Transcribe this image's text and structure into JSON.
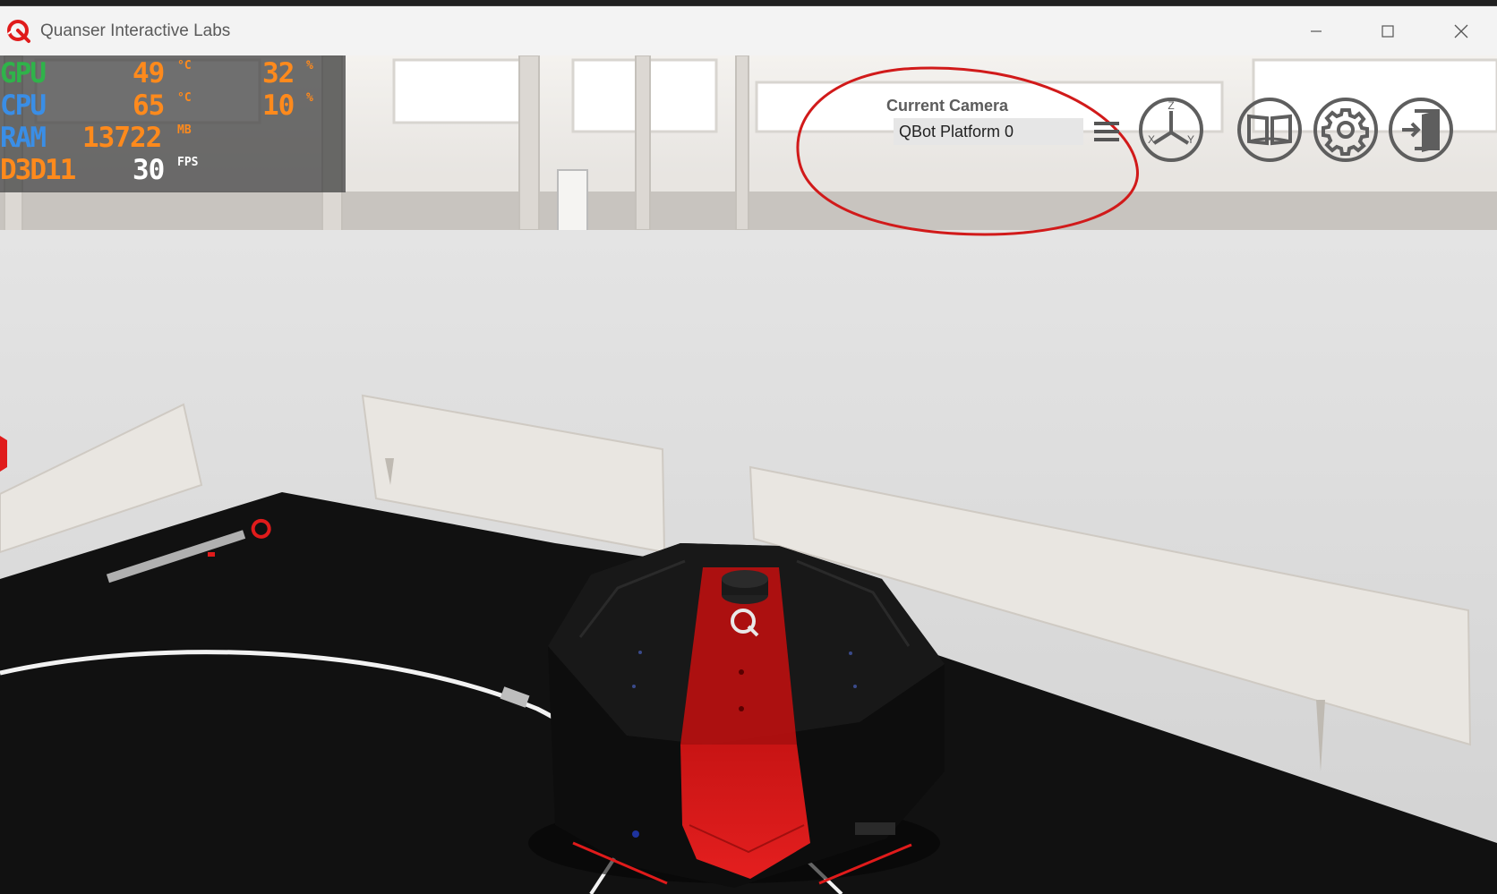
{
  "window": {
    "title": "Quanser Interactive Labs"
  },
  "perf_overlay": {
    "rows": [
      {
        "label": "GPU",
        "value1": "49",
        "unit1": "°C",
        "value2": "32",
        "unit2": "%",
        "label_color": "#2fb34a"
      },
      {
        "label": "CPU",
        "value1": "65",
        "unit1": "°C",
        "value2": "10",
        "unit2": "%",
        "label_color": "#3a8ee6"
      },
      {
        "label": "RAM",
        "value1": "13722",
        "unit1": "MB",
        "label_color": "#3a8ee6"
      },
      {
        "label": "D3D11",
        "value1": "30",
        "unit1": "FPS",
        "label_color": "#ff8a1c"
      }
    ]
  },
  "camera": {
    "label": "Current Camera",
    "selected": "QBot Platform 0"
  },
  "toolbar": {
    "axes_icon": "xyz-axes-icon",
    "book_icon": "book-icon",
    "gear_icon": "gear-icon",
    "exit_icon": "exit-icon",
    "axes_letters": {
      "z": "Z",
      "x": "X",
      "y": "Y"
    }
  },
  "colors": {
    "accent_red": "#e01b1b",
    "annotation_red": "#d11a1a",
    "perf_orange": "#ff8a1c"
  }
}
